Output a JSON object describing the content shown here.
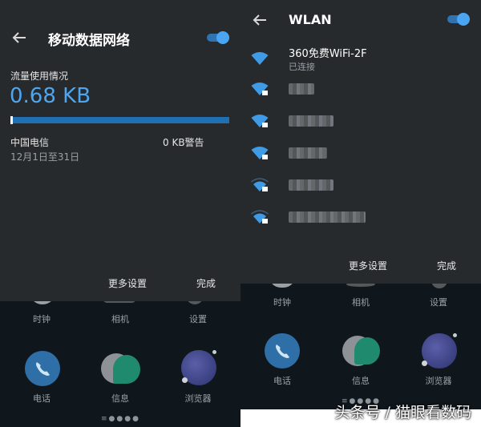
{
  "left": {
    "header": {
      "title": "移动数据网络",
      "toggle_on": true
    },
    "usage": {
      "section_label": "流量使用情况",
      "value": "0.68 KB",
      "used_fraction": 0.01
    },
    "carrier": {
      "name": "中国电信",
      "period": "12月1日至31日",
      "warning": "0 KB警告"
    },
    "buttons": {
      "more": "更多设置",
      "done": "完成"
    },
    "dock": {
      "row1": [
        "时钟",
        "相机",
        "设置"
      ],
      "row2": [
        "电话",
        "信息",
        "浏览器"
      ]
    },
    "page_dots": "≡●●●●"
  },
  "right": {
    "header": {
      "title": "WLAN",
      "toggle_on": true
    },
    "networks": [
      {
        "name": "360免费WiFi-2F",
        "status": "已连接",
        "icon": "wifi-full-icon"
      },
      {
        "icon": "wifi-locked-icon"
      },
      {
        "icon": "wifi-locked-icon"
      },
      {
        "icon": "wifi-locked-icon"
      },
      {
        "icon": "wifi-locked-icon"
      },
      {
        "icon": "wifi-locked-icon"
      }
    ],
    "buttons": {
      "more": "更多设置",
      "done": "完成"
    },
    "dock": {
      "row1": [
        "时钟",
        "相机",
        "设置"
      ],
      "row2": [
        "电话",
        "信息",
        "浏览器"
      ]
    },
    "page_dots": "≡●●●●"
  },
  "watermark": "头条号 / 猫眼看数码",
  "colors": {
    "accent": "#4da6ef",
    "panel": "#262a2d",
    "home": "#0f171d"
  }
}
